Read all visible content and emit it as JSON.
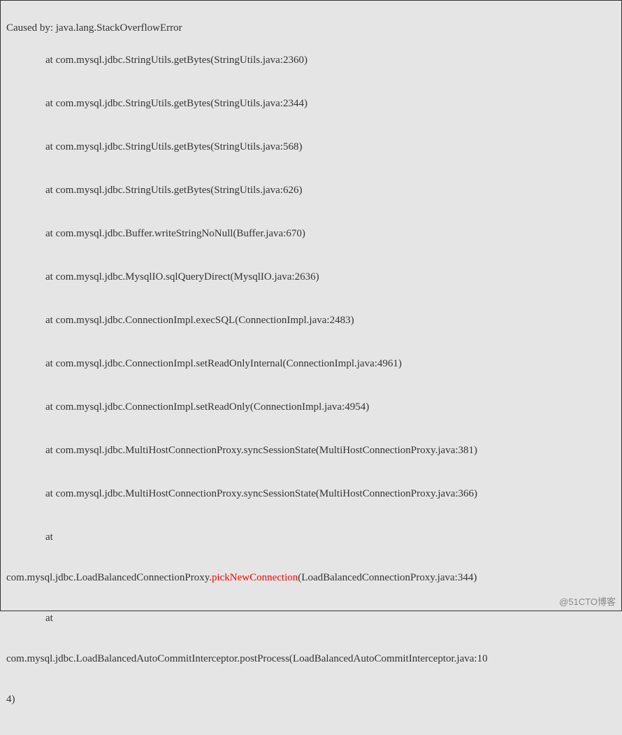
{
  "header": "Caused by: java.lang.StackOverflowError",
  "frames": [
    "at com.mysql.jdbc.StringUtils.getBytes(StringUtils.java:2360)",
    "at com.mysql.jdbc.StringUtils.getBytes(StringUtils.java:2344)",
    "at com.mysql.jdbc.StringUtils.getBytes(StringUtils.java:568)",
    "at com.mysql.jdbc.StringUtils.getBytes(StringUtils.java:626)",
    "at com.mysql.jdbc.Buffer.writeStringNoNull(Buffer.java:670)",
    "at com.mysql.jdbc.MysqlIO.sqlQueryDirect(MysqlIO.java:2636)",
    "at com.mysql.jdbc.ConnectionImpl.execSQL(ConnectionImpl.java:2483)",
    "at com.mysql.jdbc.ConnectionImpl.setReadOnlyInternal(ConnectionImpl.java:4961)",
    "at com.mysql.jdbc.ConnectionImpl.setReadOnly(ConnectionImpl.java:4954)",
    "at com.mysql.jdbc.MultiHostConnectionProxy.syncSessionState(MultiHostConnectionProxy.java:381)",
    "at com.mysql.jdbc.MultiHostConnectionProxy.syncSessionState(MultiHostConnectionProxy.java:366)"
  ],
  "at_label": "at",
  "highlighted": {
    "prefix": "com.mysql.jdbc.LoadBalancedConnectionProxy.",
    "method": "pickNewConnection",
    "suffix": "(LoadBalancedConnectionProxy.java:344)"
  },
  "final_continuation_a": "com.mysql.jdbc.LoadBalancedAutoCommitInterceptor.postProcess(LoadBalancedAutoCommitInterceptor.java:10",
  "final_continuation_b": "4)",
  "watermark": "@51CTO博客"
}
